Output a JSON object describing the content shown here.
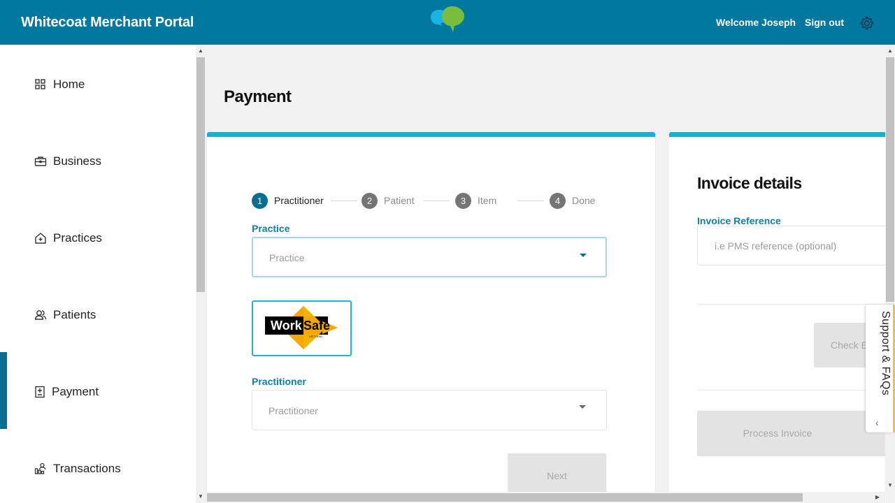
{
  "header": {
    "title": "Whitecoat Merchant Portal",
    "welcome": "Welcome Joseph",
    "signout": "Sign out",
    "logo_icon": "speech-bubbles-logo",
    "settings_icon": "gear-icon"
  },
  "sidebar": {
    "items": [
      {
        "label": "Home",
        "icon": "grid-icon"
      },
      {
        "label": "Business",
        "icon": "briefcase-icon"
      },
      {
        "label": "Practices",
        "icon": "house-plus-icon"
      },
      {
        "label": "Patients",
        "icon": "people-icon"
      },
      {
        "label": "Payment",
        "icon": "receipt-icon",
        "active": true
      },
      {
        "label": "Transactions",
        "icon": "chart-user-icon"
      }
    ]
  },
  "main": {
    "title": "Payment",
    "stepper": [
      {
        "num": "1",
        "label": "Practitioner",
        "active": true
      },
      {
        "num": "2",
        "label": "Patient"
      },
      {
        "num": "3",
        "label": "Item"
      },
      {
        "num": "4",
        "label": "Done"
      }
    ],
    "practice": {
      "label": "Practice",
      "placeholder": "Practice"
    },
    "insurer": {
      "logo_text_left": "Work",
      "logo_text_right": "Safe",
      "logo_subtext": "VICTORIA"
    },
    "practitioner": {
      "label": "Practitioner",
      "placeholder": "Practitioner"
    },
    "next_label": "Next"
  },
  "invoice": {
    "title": "Invoice details",
    "reference_label": "Invoice Reference",
    "reference_placeholder": "i.e PMS reference (optional)",
    "check_label": "Check Eligibility",
    "process_label": "Process Invoice"
  },
  "support": {
    "label": "Support & FAQs"
  },
  "colors": {
    "header": "#0078a0",
    "accent": "#0db3e0",
    "label": "#137f9e",
    "active_bar": "#0a6f8f",
    "support_border": "#f1c232"
  }
}
